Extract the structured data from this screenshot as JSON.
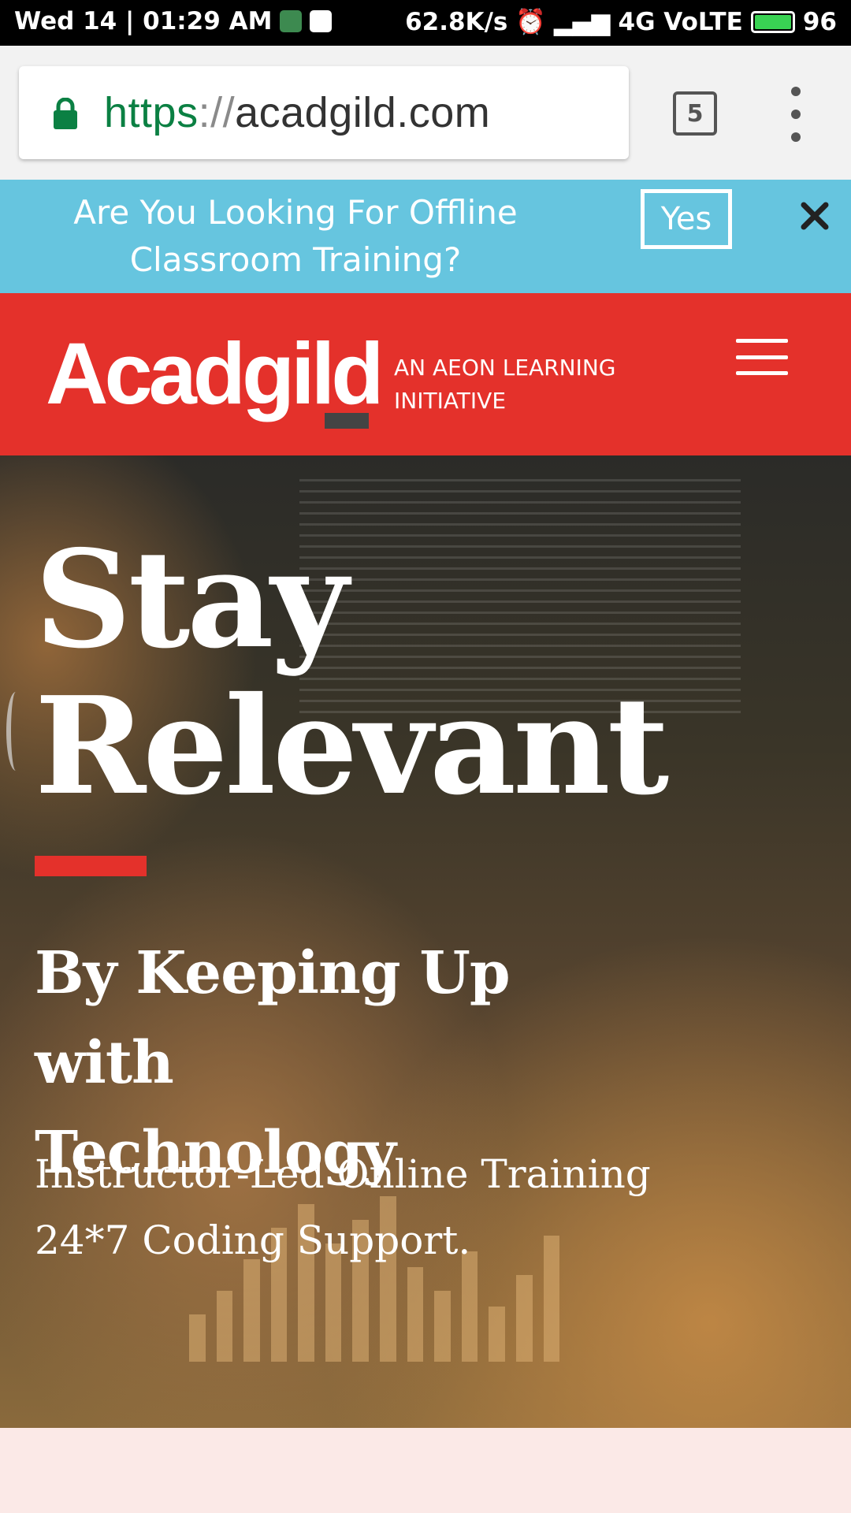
{
  "status_bar": {
    "datetime": "Wed 14 | 01:29 AM",
    "net_speed": "62.8K/s",
    "network": "4G VoLTE",
    "battery": "96"
  },
  "browser": {
    "url_scheme": "https",
    "url_separator": "://",
    "url_host": "acadgild.com",
    "tab_count": "5"
  },
  "banner": {
    "line1": "Are You Looking For Offline",
    "line2": "Classroom Training?",
    "yes_label": "Yes"
  },
  "header": {
    "logo_text": "Acadgild",
    "tagline_line1": "AN AEON LEARNING",
    "tagline_line2": "INITIATIVE"
  },
  "hero": {
    "headline_line1": "Stay",
    "headline_line2": "Relevant",
    "subhead_line1": "By Keeping Up with",
    "subhead_line2": "Technology",
    "desc_line1": "Instructor-Led Online Training",
    "desc_line2": "24*7 Coding Support."
  },
  "colors": {
    "brand_red": "#e4312b",
    "banner_blue": "#66c5df",
    "secure_green": "#0b8043"
  }
}
